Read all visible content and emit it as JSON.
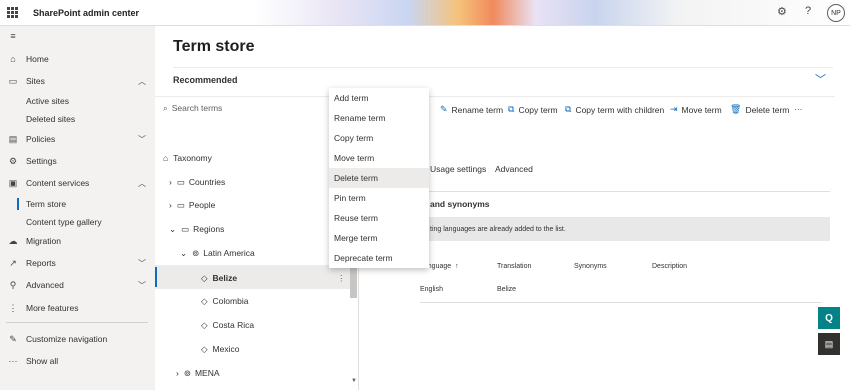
{
  "app": {
    "title": "SharePoint admin center",
    "avatar_initials": "NP",
    "accent_color": "#0f6cbd"
  },
  "nav": {
    "items": [
      {
        "label": "Home",
        "icon": "home-icon"
      },
      {
        "label": "Sites",
        "icon": "sites-icon",
        "expanded": true
      },
      {
        "label": "Active sites"
      },
      {
        "label": "Deleted sites"
      },
      {
        "label": "Policies",
        "icon": "policies-icon"
      },
      {
        "label": "Settings",
        "icon": "gear-icon"
      },
      {
        "label": "Content services",
        "icon": "content-services-icon",
        "expanded": true
      },
      {
        "label": "Term store",
        "active": true
      },
      {
        "label": "Content type gallery"
      },
      {
        "label": "Migration",
        "icon": "migration-icon"
      },
      {
        "label": "Reports",
        "icon": "reports-icon"
      },
      {
        "label": "Advanced",
        "icon": "advanced-icon"
      },
      {
        "label": "More features",
        "icon": "more-features-icon"
      },
      {
        "label": "Customize navigation",
        "icon": "pencil-icon"
      },
      {
        "label": "Show all",
        "icon": "ellipsis-icon"
      }
    ]
  },
  "page": {
    "title": "Term store",
    "recommended": "Recommended"
  },
  "tree": {
    "search_placeholder": "Search terms",
    "root": "Taxonomy",
    "items": [
      {
        "label": "Countries"
      },
      {
        "label": "People"
      },
      {
        "label": "Regions"
      },
      {
        "label": "Latin America"
      },
      {
        "label": "Belize",
        "selected": true
      },
      {
        "label": "Colombia"
      },
      {
        "label": "Costa Rica"
      },
      {
        "label": "Mexico"
      },
      {
        "label": "MENA"
      }
    ]
  },
  "context_menu": {
    "items": [
      "Add term",
      "Rename term",
      "Copy term",
      "Move term",
      "Delete term",
      "Pin term",
      "Reuse term",
      "Merge term",
      "Deprecate term"
    ],
    "highlighted": "Delete term"
  },
  "commandbar": {
    "items": [
      "Rename term",
      "Copy term",
      "Copy term with children",
      "Move term",
      "Delete term"
    ],
    "partial_first": "n"
  },
  "tabs": [
    "Usage settings",
    "Advanced"
  ],
  "section": {
    "heading": "and synonyms",
    "info": "ting languages are already added to the list."
  },
  "table": {
    "headers": [
      "Language",
      "Translation",
      "Synonyms",
      "Description"
    ],
    "rows": [
      [
        "English",
        "Belize",
        "",
        ""
      ]
    ]
  },
  "fab": {
    "primary_icon": "q-icon",
    "secondary_icon": "chat-icon"
  }
}
